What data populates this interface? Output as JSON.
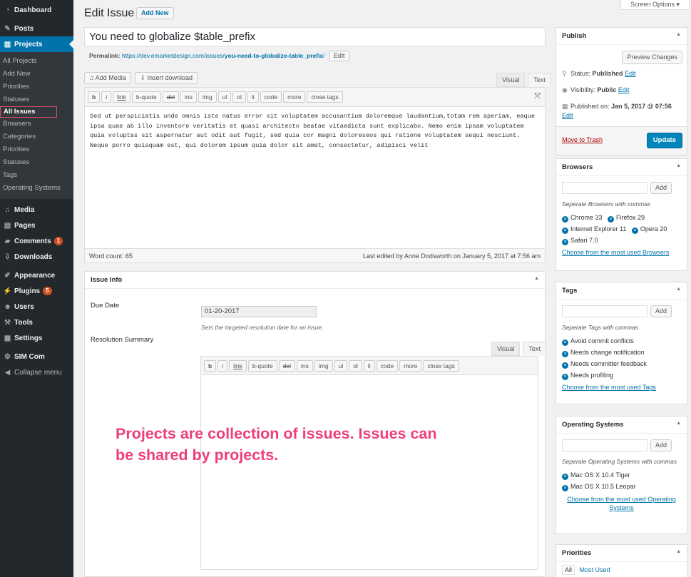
{
  "sidebar": {
    "dashboard": "Dashboard",
    "posts": "Posts",
    "projects": "Projects",
    "projects_sub": [
      "All Projects",
      "Add New",
      "Priorities",
      "Statuses"
    ],
    "issues_current": "All Issues",
    "issues_sub": [
      "Browsers",
      "Categories",
      "Priorities",
      "Statuses",
      "Tags",
      "Operating Systems"
    ],
    "media": "Media",
    "pages": "Pages",
    "comments": "Comments",
    "comments_badge": "1",
    "downloads": "Downloads",
    "appearance": "Appearance",
    "plugins": "Plugins",
    "plugins_badge": "5",
    "users": "Users",
    "tools": "Tools",
    "settings": "Settings",
    "sim_com": "SIM Com",
    "collapse": "Collapse menu"
  },
  "header": {
    "title": "Edit Issue",
    "add_new": "Add New",
    "screen_options": "Screen Options ▾"
  },
  "post": {
    "title": "You need to globalize $table_prefix",
    "permalink_label": "Permalink:",
    "permalink_base": "https://dev.emarketdesign.com/issues/",
    "permalink_slug": "you-need-to-globalize-table_prefix",
    "permalink_end": "/",
    "permalink_edit": "Edit"
  },
  "editor": {
    "add_media": "Add Media",
    "insert_download": "Insert download",
    "tab_visual": "Visual",
    "tab_text": "Text",
    "buttons": [
      "b",
      "i",
      "link",
      "b-quote",
      "del",
      "ins",
      "img",
      "ul",
      "ol",
      "li",
      "code",
      "more",
      "close tags"
    ],
    "content": "Sed ut perspiciatis unde omnis iste natus error sit voluptatem accusantium doloremque laudantium,totam rem aperiam, eaque ipsa quae ab illo inventore veritatis et quasi architecto beatae vitaedicta sunt explicabo. Nemo enim ipsam voluptatem quia voluptas sit aspernatur aut odit aut fugit, sed quia cor magni doloreseos qui ratione voluptatem sequi nesciunt. Neque porro quisquam est, qui dolorem ipsum quia dolor sit amet, consectetur, adipisci velit",
    "word_count": "Word count: 65",
    "last_edited": "Last edited by Anne Dodsworth on January 5, 2017 at 7:56 am"
  },
  "issue_info": {
    "title": "Issue Info",
    "due_label": "Due Date",
    "due_value": "01-20-2017",
    "due_desc": "Sets the targeted resolution date for an issue.",
    "resolution_label": "Resolution Summary",
    "tab_visual": "Visual",
    "tab_text": "Text"
  },
  "annotation": "Projects are collection of issues. Issues can be shared by projects.",
  "publish": {
    "title": "Publish",
    "preview": "Preview Changes",
    "status_label": "Status:",
    "status_value": "Published",
    "visibility_label": "Visibility:",
    "visibility_value": "Public",
    "published_label": "Published on:",
    "published_value": "Jan 5, 2017 @ 07:56",
    "edit": "Edit",
    "trash": "Move to Trash",
    "update": "Update"
  },
  "browsers": {
    "title": "Browsers",
    "add": "Add",
    "hint": "Seperate Browsers with commas",
    "tags": [
      "Chrome 33",
      "Firefox 29",
      "Internet Explorer 11",
      "Opera 20",
      "Safari 7.0"
    ],
    "choose": "Choose from the most used Browsers"
  },
  "tags": {
    "title": "Tags",
    "add": "Add",
    "hint": "Seperate Tags with commas",
    "tags": [
      "Avoid commit conflicts",
      "Needs change notification",
      "Needs committer feedback",
      "Needs profiling"
    ],
    "choose": "Choose from the most used Tags"
  },
  "os": {
    "title": "Operating Systems",
    "add": "Add",
    "hint": "Seperate Operating Systems with commas",
    "tags": [
      "Mac OS X 10.4 Tiger",
      "Mac OS X 10.5 Leopar"
    ],
    "choose": "Choose from the most used Operating Systems"
  },
  "priorities": {
    "title": "Priorities",
    "tab_all": "All",
    "tab_most_used": "Most Used"
  },
  "colors": {
    "admin_bar": "#23282d",
    "accent": "#0073aa",
    "annotation": "#ee3d7d"
  }
}
